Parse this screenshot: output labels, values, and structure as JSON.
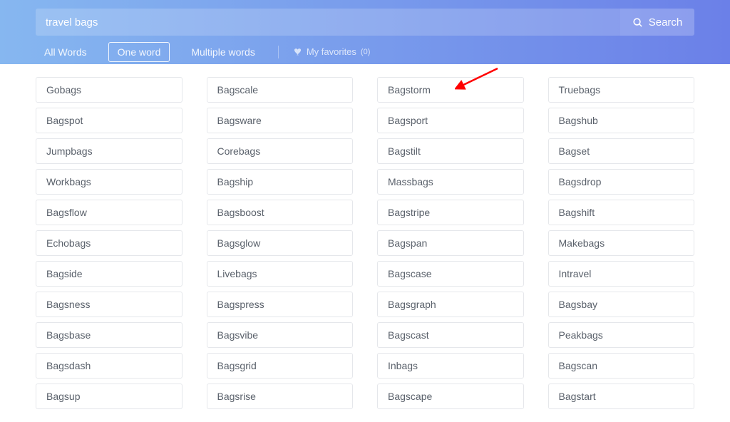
{
  "search": {
    "value": "travel bags",
    "button_label": "Search"
  },
  "tabs": {
    "all": "All Words",
    "one": "One word",
    "multi": "Multiple words"
  },
  "favorites": {
    "label": "My favorites",
    "count": "(0)"
  },
  "results": {
    "col1": [
      "Gobags",
      "Bagspot",
      "Jumpbags",
      "Workbags",
      "Bagsflow",
      "Echobags",
      "Bagside",
      "Bagsness",
      "Bagsbase",
      "Bagsdash",
      "Bagsup"
    ],
    "col2": [
      "Bagscale",
      "Bagsware",
      "Corebags",
      "Bagship",
      "Bagsboost",
      "Bagsglow",
      "Livebags",
      "Bagspress",
      "Bagsvibe",
      "Bagsgrid",
      "Bagsrise"
    ],
    "col3": [
      "Bagstorm",
      "Bagsport",
      "Bagstilt",
      "Massbags",
      "Bagstripe",
      "Bagspan",
      "Bagscase",
      "Bagsgraph",
      "Bagscast",
      "Inbags",
      "Bagscape"
    ],
    "col4": [
      "Truebags",
      "Bagshub",
      "Bagset",
      "Bagsdrop",
      "Bagshift",
      "Makebags",
      "Intravel",
      "Bagsbay",
      "Peakbags",
      "Bagscan",
      "Bagstart"
    ]
  }
}
